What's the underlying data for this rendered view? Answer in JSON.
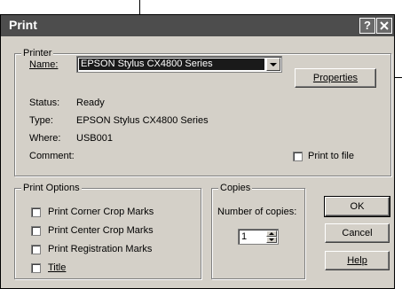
{
  "dialog": {
    "title": "Print"
  },
  "printer": {
    "group_label": "Printer",
    "name_label": "Name:",
    "name_value": "EPSON Stylus CX4800 Series",
    "properties_label": "Properties",
    "status_label": "Status:",
    "status_value": "Ready",
    "type_label": "Type:",
    "type_value": "EPSON Stylus CX4800 Series",
    "where_label": "Where:",
    "where_value": "USB001",
    "comment_label": "Comment:",
    "print_to_file_label": "Print to file",
    "print_to_file_checked": false
  },
  "print_options": {
    "group_label": "Print Options",
    "items": [
      {
        "label": "Print Corner Crop Marks",
        "checked": false
      },
      {
        "label": "Print Center Crop Marks",
        "checked": false
      },
      {
        "label": "Print Registration Marks",
        "checked": false
      },
      {
        "label": "Title",
        "checked": false
      }
    ]
  },
  "copies": {
    "group_label": "Copies",
    "number_label": "Number of copies:",
    "value": "1"
  },
  "buttons": {
    "ok": "OK",
    "cancel": "Cancel",
    "help": "Help"
  },
  "icons": {
    "help": "help-icon",
    "close": "close-icon"
  }
}
